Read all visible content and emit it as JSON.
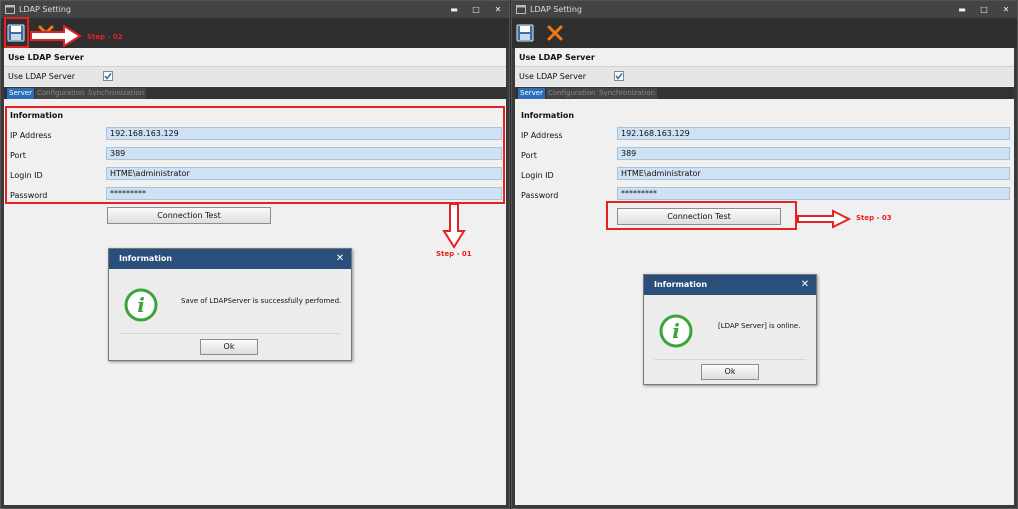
{
  "windows": [
    {
      "title": "LDAP Setting",
      "section_title": "Use LDAP Server",
      "use_ldap_label": "Use LDAP Server",
      "use_ldap_checked": true,
      "tabs": [
        "Server",
        "Configuration",
        "Synchronization"
      ],
      "active_tab": "Server",
      "info_title": "Information",
      "fields": [
        {
          "label": "IP Address",
          "value": "192.168.163.129"
        },
        {
          "label": "Port",
          "value": "389"
        },
        {
          "label": "Login ID",
          "value": "HTME\\administrator"
        },
        {
          "label": "Password",
          "value": "*********"
        }
      ],
      "connection_test_label": "Connection Test",
      "dialog": {
        "title": "Information",
        "message": "Save of LDAPServer is successfully perfomed.",
        "ok_label": "Ok"
      }
    },
    {
      "title": "LDAP Setting",
      "section_title": "Use LDAP Server",
      "use_ldap_label": "Use LDAP Server",
      "use_ldap_checked": true,
      "tabs": [
        "Server",
        "Configuration",
        "Synchronization"
      ],
      "active_tab": "Server",
      "info_title": "Information",
      "fields": [
        {
          "label": "IP Address",
          "value": "192.168.163.129"
        },
        {
          "label": "Port",
          "value": "389"
        },
        {
          "label": "Login ID",
          "value": "HTME\\administrator"
        },
        {
          "label": "Password",
          "value": "*********"
        }
      ],
      "connection_test_label": "Connection Test",
      "dialog": {
        "title": "Information",
        "message": "[LDAP Server] is online.",
        "ok_label": "Ok"
      }
    }
  ],
  "annotations": {
    "step1": "Step - 01",
    "step2": "Step - 02",
    "step3": "Step - 03"
  },
  "icons": {
    "save": "floppy-disk-icon",
    "cancel": "x-cross-icon",
    "info": "info-circle-icon",
    "app": "window-icon"
  },
  "colors": {
    "annotation": "#e52222",
    "tab_active": "#2a6fb8",
    "field_bg": "#cfe2f3",
    "dialog_title_bg": "#2a4f7a",
    "cancel_icon": "#f07a10",
    "info_icon": "#3aa33a"
  }
}
